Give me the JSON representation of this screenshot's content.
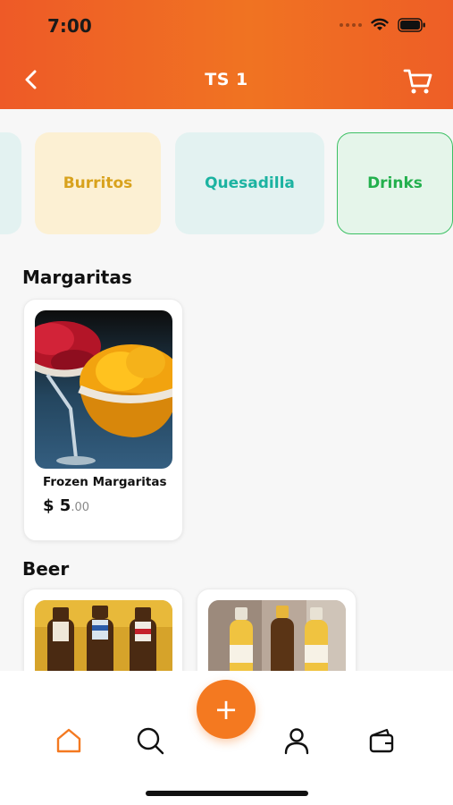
{
  "status_bar": {
    "time": "7:00"
  },
  "header": {
    "title": "TS 1"
  },
  "categories": [
    {
      "label": ""
    },
    {
      "label": "Burritos"
    },
    {
      "label": "Quesadilla"
    },
    {
      "label": "Drinks"
    }
  ],
  "sections": [
    {
      "title": "Margaritas",
      "items": [
        {
          "name": "Frozen Margaritas",
          "price_main": "$ 5",
          "price_cents": ".00"
        }
      ]
    },
    {
      "title": "Beer"
    }
  ],
  "bottom_nav": {
    "fab_label": "+"
  },
  "colors": {
    "brand": "#f07322",
    "burritos": "#d8a21d",
    "quesadilla": "#1cb3a1",
    "drinks": "#23b04d"
  },
  "icons": [
    "back-icon",
    "cart-icon",
    "home-icon",
    "search-icon",
    "profile-icon",
    "wallet-icon",
    "wifi-icon",
    "battery-icon"
  ]
}
